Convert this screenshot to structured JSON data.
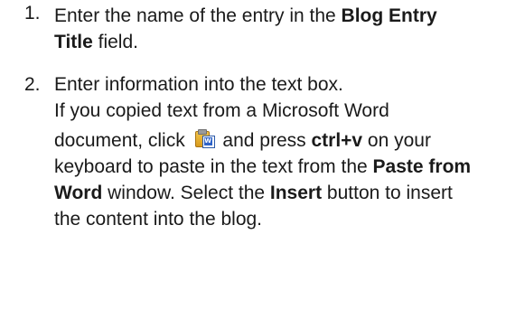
{
  "steps": [
    {
      "number": "1.",
      "text_a": "Enter the name of the entry in the ",
      "bold_a": "Blog Entry Title",
      "text_b": " field."
    },
    {
      "number": "2.",
      "line1": "Enter information into the text box.",
      "line2": "If you copied text from a Microsoft Word",
      "text_c": "document, click ",
      "icon": "paste-from-word-icon",
      "text_d": " and press ",
      "bold_b": "ctrl+v",
      "text_e": " on your keyboard to paste in the text from the ",
      "bold_c": "Paste from Word",
      "text_f": " window. Select the ",
      "bold_d": "Insert",
      "text_g": " button to insert the content into the blog."
    }
  ]
}
